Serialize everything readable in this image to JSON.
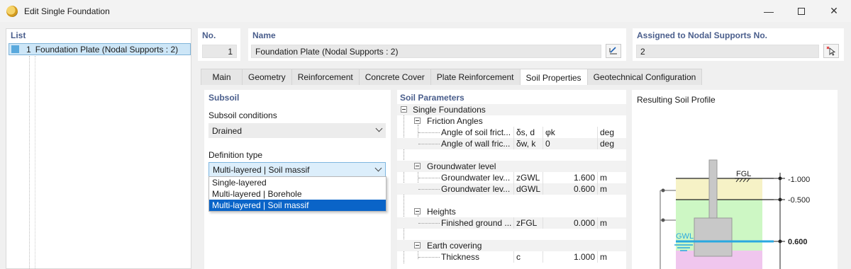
{
  "window": {
    "title": "Edit Single Foundation"
  },
  "list": {
    "header": "List",
    "items": [
      {
        "number": "1",
        "label": "Foundation Plate (Nodal Supports : 2)"
      }
    ]
  },
  "header": {
    "no_label": "No.",
    "no_value": "1",
    "name_label": "Name",
    "name_value": "Foundation Plate (Nodal Supports : 2)",
    "assigned_label": "Assigned to Nodal Supports No.",
    "assigned_value": "2"
  },
  "tabs": [
    "Main",
    "Geometry",
    "Reinforcement",
    "Concrete Cover",
    "Plate Reinforcement",
    "Soil Properties",
    "Geotechnical Configuration"
  ],
  "active_tab": "Soil Properties",
  "subsoil": {
    "header": "Subsoil",
    "conditions_label": "Subsoil conditions",
    "conditions_value": "Drained",
    "definition_label": "Definition type",
    "definition_value": "Multi-layered | Soil massif",
    "options": [
      "Single-layered",
      "Multi-layered | Borehole",
      "Multi-layered | Soil massif"
    ],
    "selected_option": "Multi-layered | Soil massif"
  },
  "soil_parameters": {
    "header": "Soil Parameters",
    "root": "Single Foundations",
    "groups": [
      {
        "title": "Friction Angles",
        "rows": [
          {
            "label": "Angle of soil frict...",
            "symbol": "δs, d",
            "value": "φk",
            "unit": "deg"
          },
          {
            "label": "Angle of wall fric...",
            "symbol": "δw, k",
            "value": "0",
            "unit": "deg"
          }
        ]
      },
      {
        "title": "Groundwater level",
        "rows": [
          {
            "label": "Groundwater lev...",
            "symbol": "zGWL",
            "value": "1.600",
            "unit": "m"
          },
          {
            "label": "Groundwater lev...",
            "symbol": "dGWL",
            "value": "0.600",
            "unit": "m"
          }
        ]
      },
      {
        "title": "Heights",
        "rows": [
          {
            "label": "Finished ground ...",
            "symbol": "zFGL",
            "value": "0.000",
            "unit": "m"
          }
        ]
      },
      {
        "title": "Earth covering",
        "rows": [
          {
            "label": "Thickness",
            "symbol": "c",
            "value": "1.000",
            "unit": "m"
          }
        ]
      }
    ]
  },
  "profile": {
    "title": "Resulting Soil Profile",
    "labels": {
      "fgl": "FGL",
      "gwl": "GWL"
    },
    "levels": [
      "-1.000",
      "-0.500",
      "0.600"
    ],
    "colors": {
      "top_layer": "#f6f2c6",
      "middle_layer": "#cdf7c4",
      "bottom_layer": "#f0c6ee",
      "foundation": "#c8c8c8",
      "water": "#29a8e0"
    }
  }
}
